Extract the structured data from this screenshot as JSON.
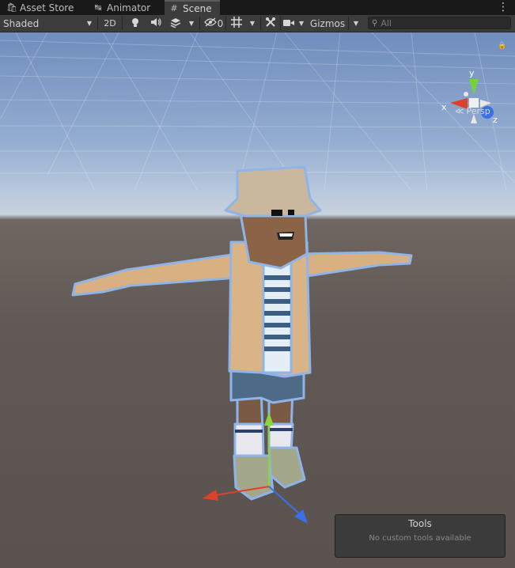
{
  "tabs": [
    {
      "label": "Asset Store",
      "icon": "shopping-bag-icon",
      "active": false
    },
    {
      "label": "Animator",
      "icon": "animator-icon",
      "active": false
    },
    {
      "label": "Scene",
      "icon": "hash-grid-icon",
      "active": true
    }
  ],
  "toolbar": {
    "draw_mode": "Shaded",
    "toggle_2d": "2D",
    "hidden_count": "0",
    "gizmos_label": "Gizmos",
    "search_placeholder": "All"
  },
  "scene_gizmo": {
    "x_label": "x",
    "y_label": "y",
    "z_label": "z",
    "projection": "Persp",
    "x_color": "#e0402a",
    "y_color": "#72d43a",
    "z_color": "#3a6fe8"
  },
  "tools_overlay": {
    "title": "Tools",
    "message": "No custom tools available"
  }
}
